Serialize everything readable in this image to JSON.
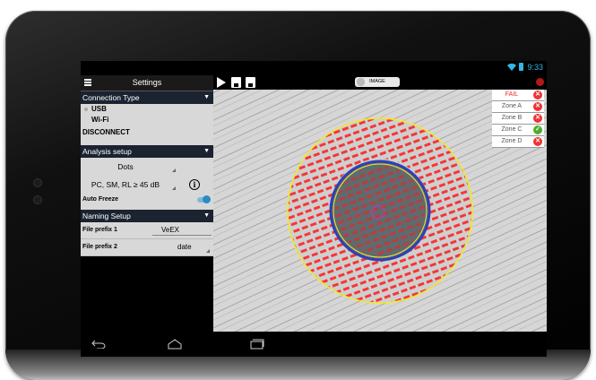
{
  "status": {
    "time": "9:33"
  },
  "sidebar": {
    "title": "Settings",
    "connection": {
      "header": "Connection Type",
      "options": [
        "USB",
        "Wi-Fi"
      ],
      "disconnect_label": "DISCONNECT"
    },
    "analysis": {
      "header": "Analysis setup",
      "mode": "Dots",
      "profile": "PC, SM, RL ≥ 45 dB",
      "auto_freeze_label": "Auto Freeze",
      "auto_freeze_on": true
    },
    "naming": {
      "header": "Naming Setup",
      "prefix1_label": "File prefix 1",
      "prefix1_value": "VeEX",
      "prefix2_label": "File prefix 2",
      "prefix2_value": "date"
    }
  },
  "toolbar": {
    "image_toggle_label": "IMAGE",
    "icons": [
      "play-icon",
      "save-icon",
      "save-as-icon",
      "record-icon"
    ]
  },
  "results": [
    {
      "label": "FAIL",
      "status": "fail"
    },
    {
      "label": "Zone A",
      "status": "fail"
    },
    {
      "label": "Zone B",
      "status": "fail"
    },
    {
      "label": "Zone C",
      "status": "pass"
    },
    {
      "label": "Zone D",
      "status": "fail"
    }
  ],
  "colors": {
    "fail": "#e33333",
    "pass": "#4caf2a",
    "accent": "#33b5e5",
    "defects": "#ff1a1a",
    "zone_outer": "#f2e82a",
    "core_ring": "#2f3fb8"
  }
}
